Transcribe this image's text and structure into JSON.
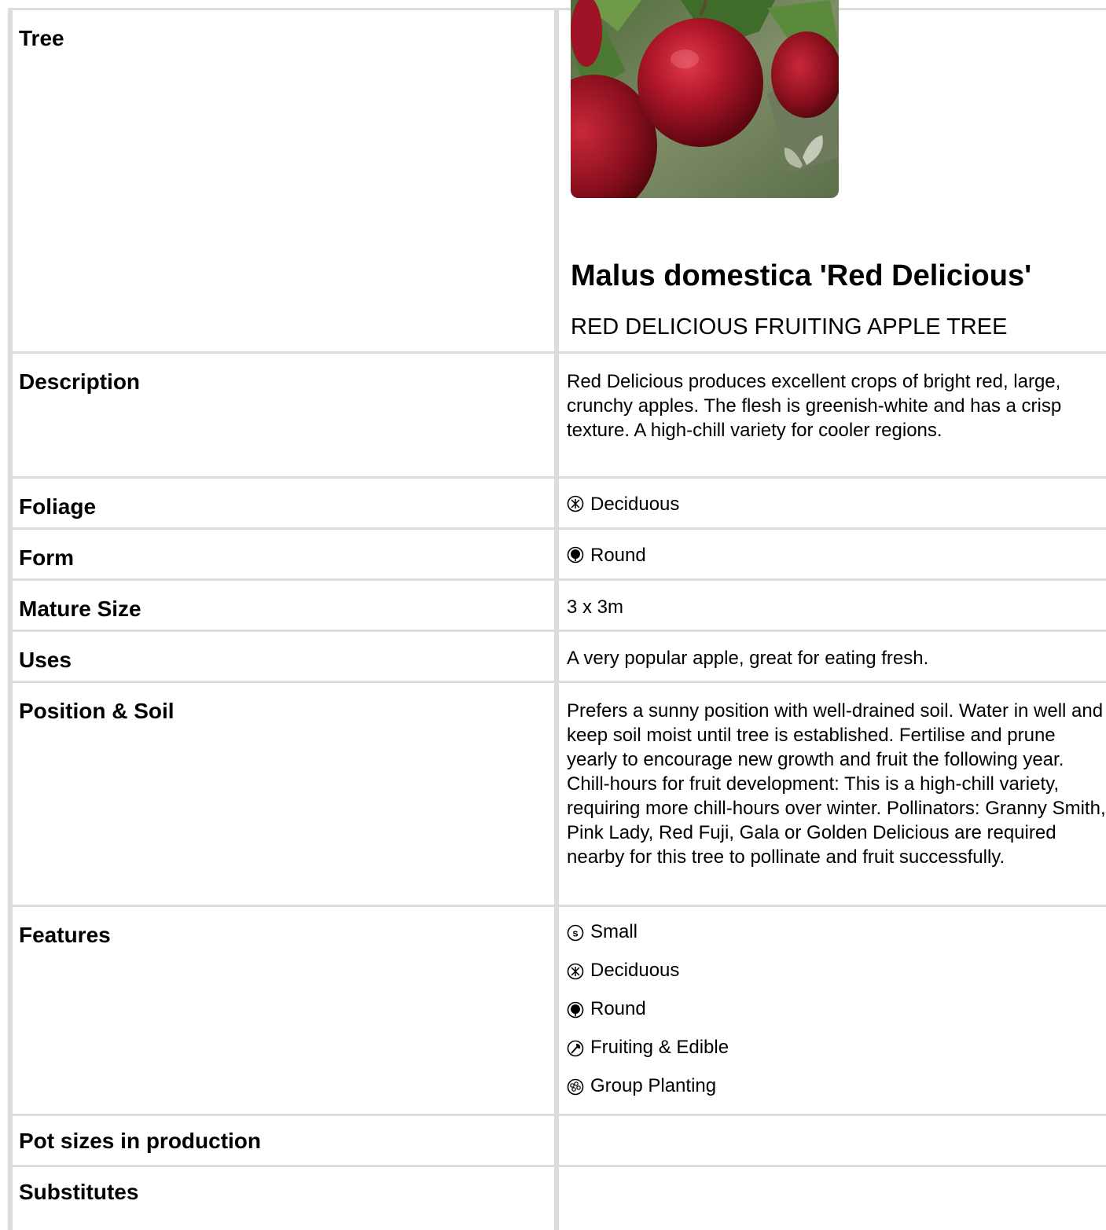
{
  "product": {
    "botanical_name": "Malus domestica 'Red Delicious'",
    "common_name": "RED DELICIOUS FRUITING APPLE TREE",
    "image_icon": "leaf-watermark-icon"
  },
  "rows": {
    "tree": {
      "label": "Tree"
    },
    "description": {
      "label": "Description",
      "value": "Red Delicious produces excellent crops of bright red, large, crunchy apples. The flesh is greenish-white and has a crisp texture. A high-chill variety for cooler regions."
    },
    "foliage": {
      "label": "Foliage",
      "value": "Deciduous",
      "icon": "deciduous-icon"
    },
    "form": {
      "label": "Form",
      "value": "Round",
      "icon": "round-icon"
    },
    "mature_size": {
      "label": "Mature Size",
      "value": "3 x 3m"
    },
    "uses": {
      "label": "Uses",
      "value": "A very popular apple, great for eating fresh."
    },
    "position_soil": {
      "label": "Position & Soil",
      "value": "Prefers a sunny position with well-drained soil. Water in well and keep soil moist until tree is established. Fertilise and prune yearly to encourage new growth and fruit the following year. Chill-hours for fruit development: This is a high-chill variety, requiring more chill-hours over winter. Pollinators: Granny Smith, Pink Lady, Red Fuji, Gala or Golden Delicious are required nearby for this tree to pollinate and fruit successfully."
    },
    "features": {
      "label": "Features",
      "items": [
        {
          "label": "Small",
          "icon": "small-icon"
        },
        {
          "label": "Deciduous",
          "icon": "deciduous-icon"
        },
        {
          "label": "Round",
          "icon": "round-icon"
        },
        {
          "label": "Fruiting & Edible",
          "icon": "fruiting-edible-icon"
        },
        {
          "label": "Group Planting",
          "icon": "group-planting-icon"
        }
      ]
    },
    "pot_sizes": {
      "label": "Pot sizes in production",
      "value": ""
    },
    "substitutes": {
      "label": "Substitutes",
      "value": ""
    }
  }
}
